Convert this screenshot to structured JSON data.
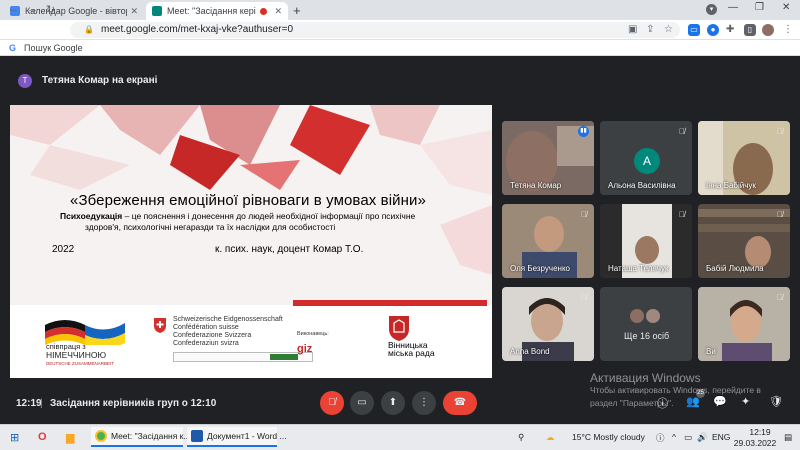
{
  "browser": {
    "tabs": [
      {
        "label": "Календар Google - вівторок, 29",
        "active": false
      },
      {
        "label": "Meet: \"Засідання керівник",
        "active": true
      }
    ],
    "new_tab_glyph": "+",
    "window_controls": {
      "minimize": "—",
      "restore": "❐",
      "close": "✕"
    },
    "url": "meet.google.com/met-kxaj-vke?authuser=0",
    "bookmark": "Пошук Google"
  },
  "meet": {
    "presenter_initial": "T",
    "presenter_text": "Тетяна Комар на екрані",
    "slide": {
      "title": "«Збереження емоційної рівноваги в умовах  війни»",
      "sub_bold": "Психоедукація",
      "sub_rest": " – це пояснення і донесення до людей необхідної інформації про психічне",
      "sub_line2": "здоров'я, психологічні негаразди та їх наслідки для особистості",
      "year": "2022",
      "author": "к. псих. наук, доцент Комар Т.О.",
      "de_logo": {
        "line1": "співпраця з",
        "line2": "НІМЕЧЧИНОЮ",
        "line3": "DEUTSCHE ZUSAMMENARBEIT"
      },
      "ch_logo": [
        "Schweizerische Eidgenossenschaft",
        "Confédération suisse",
        "Confederazione Svizzera",
        "Confederaziun svizra"
      ],
      "implement_label": "Виконавець:",
      "giz": "giz",
      "vin_logo": [
        "Вінницька",
        "міська рада"
      ]
    },
    "tiles": [
      {
        "name": "Тетяна Комар",
        "mic": "speaking",
        "avatar": ""
      },
      {
        "name": "Альона Василівна",
        "mic": "off",
        "avatar": "A"
      },
      {
        "name": "Інна Бабійчук",
        "mic": "off",
        "avatar": ""
      },
      {
        "name": "Оля Безрученко",
        "mic": "off",
        "avatar": ""
      },
      {
        "name": "Наташа Телячук",
        "mic": "off",
        "avatar": ""
      },
      {
        "name": "Бабій Людмила",
        "mic": "off",
        "avatar": ""
      },
      {
        "name": "Anna Bond",
        "mic": "off",
        "avatar": ""
      },
      {
        "name": "Ще 16 осіб",
        "mic": "",
        "avatar": ""
      },
      {
        "name": "Ви",
        "mic": "off",
        "avatar": ""
      }
    ],
    "watermark": {
      "title": "Активация Windows",
      "line1": "Чтобы активировать Windows, перейдите в",
      "line2": "раздел \"Параметры\"."
    },
    "clock": "12:19",
    "separator": "|",
    "meeting_title": "Засідання керівників груп о 12:10",
    "participants_badge": "25"
  },
  "taskbar": {
    "apps": [
      {
        "label": "Meet: \"Засідання к..."
      },
      {
        "label": "Документ1 - Word ..."
      }
    ],
    "weather": "15°C  Mostly cloudy",
    "lang": "ENG",
    "time": "12:19",
    "date": "29.03.2022"
  },
  "colors": {
    "accent_blue": "#1a73e8",
    "hangup_red": "#ea4335",
    "meet_bg": "#202124"
  }
}
